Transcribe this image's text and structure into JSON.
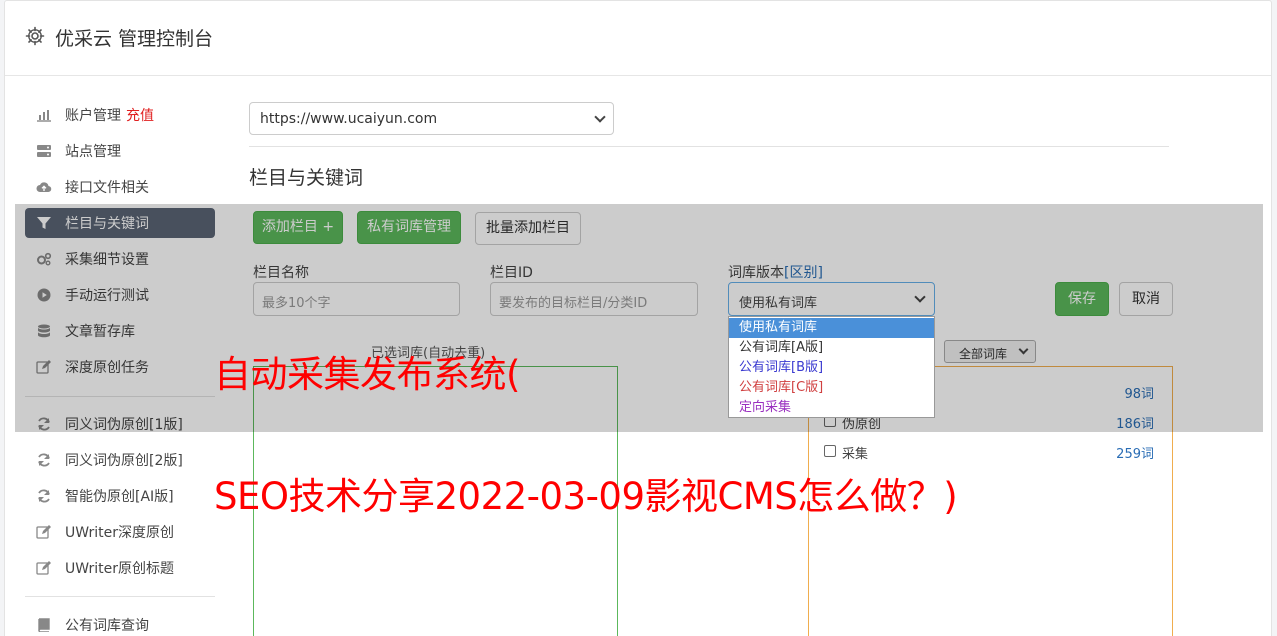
{
  "header": {
    "title": "优采云 管理控制台"
  },
  "sidebar": {
    "items": [
      {
        "label": "账户管理",
        "badge": "充值",
        "icon": "bar-chart-icon"
      },
      {
        "label": "站点管理",
        "icon": "server-icon"
      },
      {
        "label": "接口文件相关",
        "icon": "cloud-upload-icon"
      },
      {
        "label": "栏目与关键词",
        "icon": "filter-icon",
        "active": true
      },
      {
        "label": "采集细节设置",
        "icon": "gears-icon"
      },
      {
        "label": "手动运行测试",
        "icon": "play-icon"
      },
      {
        "label": "文章暂存库",
        "icon": "database-icon"
      },
      {
        "label": "深度原创任务",
        "icon": "edit-icon"
      },
      {
        "label": "同义词伪原创[1版]",
        "icon": "refresh-icon"
      },
      {
        "label": "同义词伪原创[2版]",
        "icon": "refresh-icon"
      },
      {
        "label": "智能伪原创[AI版]",
        "icon": "refresh-icon"
      },
      {
        "label": "UWriter深度原创",
        "icon": "edit-icon"
      },
      {
        "label": "UWriter原创标题",
        "icon": "edit-icon"
      },
      {
        "label": "公有词库查询",
        "icon": "book-icon"
      }
    ]
  },
  "main": {
    "site_select": {
      "value": "https://www.ucaiyun.com"
    },
    "section_title": "栏目与关键词",
    "buttons": {
      "add_column": "添加栏目 +",
      "private_lib": "私有词库管理",
      "batch_add": "批量添加栏目",
      "save": "保存",
      "cancel": "取消"
    },
    "form": {
      "name_label": "栏目名称",
      "name_placeholder": "最多10个字",
      "id_label": "栏目ID",
      "id_placeholder": "要发布的目标栏目/分类ID",
      "lib_label": "词库版本",
      "lib_link": "[区别]",
      "lib_selected": "使用私有词库"
    },
    "dropdown_options": [
      {
        "label": "使用私有词库",
        "color": "#ffffff",
        "selected": true
      },
      {
        "label": "公有词库[A版]",
        "color": "#333333"
      },
      {
        "label": "公有词库[B版]",
        "color": "#3a3ad0"
      },
      {
        "label": "公有词库[C版]",
        "color": "#d04040"
      },
      {
        "label": "定向采集",
        "color": "#9a30c0"
      }
    ],
    "selected_libs_title": "已选词库(自动去重)",
    "filter_select": "全部词库",
    "libraries": [
      {
        "name": "",
        "count": "98词"
      },
      {
        "name": "伪原创",
        "count": "186词"
      },
      {
        "name": "采集",
        "count": "259词"
      }
    ]
  },
  "overlay_text": {
    "line1": "自动采集发布系统(",
    "line2": "SEO技术分享2022-03-09影视CMS怎么做？)"
  }
}
